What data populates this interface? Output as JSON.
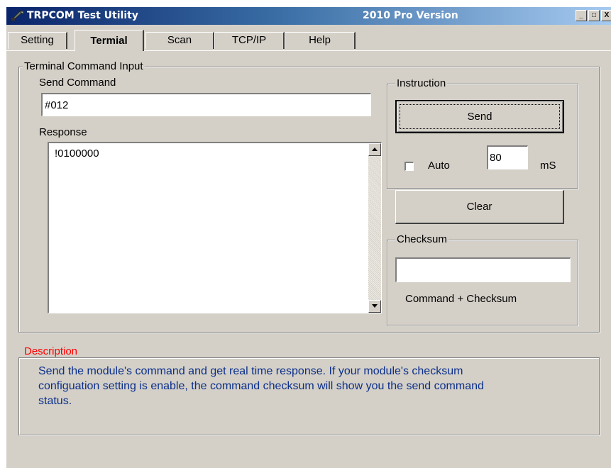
{
  "window": {
    "title": "TRPCOM Test Utility",
    "version": "2010 Pro Version",
    "buttons": {
      "minimize": "_",
      "maximize": "□",
      "close": "X"
    }
  },
  "tabs": [
    {
      "label": "Setting",
      "active": false
    },
    {
      "label": "Termial",
      "active": true
    },
    {
      "label": "Scan",
      "active": false
    },
    {
      "label": "TCP/IP",
      "active": false
    },
    {
      "label": "Help",
      "active": false
    }
  ],
  "terminal": {
    "group_label": "Terminal Command Input",
    "send_command_label": "Send Command",
    "send_command_value": "#012",
    "response_label": "Response",
    "response_value": "!0100000"
  },
  "instruction": {
    "group_label": "Instruction",
    "send_button": "Send",
    "auto_label": "Auto",
    "auto_checked": false,
    "interval_value": "80",
    "interval_unit": "mS",
    "clear_button": "Clear"
  },
  "checksum": {
    "group_label": "Checksum",
    "value": "",
    "caption": "Command + Checksum"
  },
  "description": {
    "group_label": "Description",
    "lines": [
      "Send the module's command and get  real time response. If your module's checksum",
      "configuation setting is enable, the command checksum will show you the send command",
      "status."
    ]
  },
  "colors": {
    "title_gradient_start": "#0a246a",
    "title_gradient_end": "#a6caf0",
    "dialog_face": "#d4d0c8",
    "description_label": "#ff0000",
    "description_text": "#0b2f8a"
  }
}
